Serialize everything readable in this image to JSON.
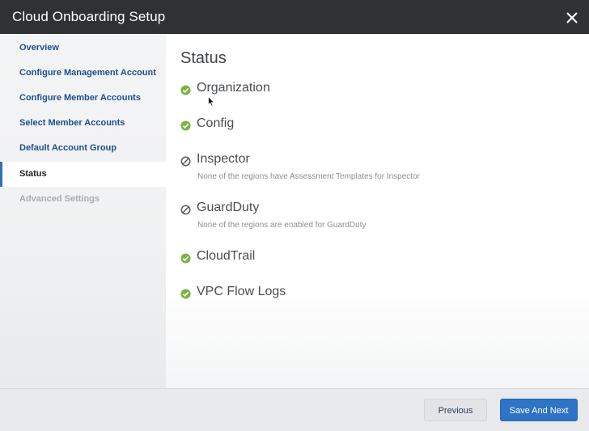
{
  "dialog": {
    "title": "Cloud Onboarding Setup",
    "close_icon": "close-icon"
  },
  "sidebar": {
    "items": [
      {
        "label": "Overview",
        "state": "link"
      },
      {
        "label": "Configure Management Account",
        "state": "link"
      },
      {
        "label": "Configure Member Accounts",
        "state": "link"
      },
      {
        "label": "Select Member Accounts",
        "state": "link"
      },
      {
        "label": "Default Account Group",
        "state": "link"
      },
      {
        "label": "Status",
        "state": "active"
      },
      {
        "label": "Advanced Settings",
        "state": "disabled"
      }
    ]
  },
  "main": {
    "title": "Status",
    "statuses": [
      {
        "label": "Organization",
        "icon": "check-circle-icon",
        "note": ""
      },
      {
        "label": "Config",
        "icon": "check-circle-icon",
        "note": ""
      },
      {
        "label": "Inspector",
        "icon": "disabled-circle-icon",
        "note": "None of the regions have Assessment Templates for Inspector"
      },
      {
        "label": "GuardDuty",
        "icon": "disabled-circle-icon",
        "note": "None of the regions are enabled for GuardDuty"
      },
      {
        "label": "CloudTrail",
        "icon": "check-circle-icon",
        "note": ""
      },
      {
        "label": "VPC Flow Logs",
        "icon": "check-circle-icon",
        "note": ""
      }
    ]
  },
  "footer": {
    "previous_label": "Previous",
    "next_label": "Save And Next"
  },
  "colors": {
    "titlebar": "#2f3235",
    "link": "#1f4e8c",
    "success": "#7cb342",
    "primary_button": "#2f73c6"
  }
}
